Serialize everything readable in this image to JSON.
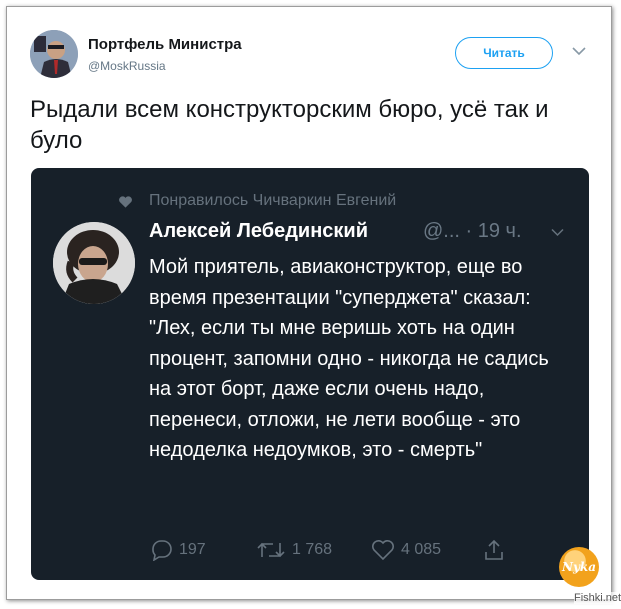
{
  "tweet": {
    "author_name": "Портфель Министра",
    "author_handle": "@MoskRussia",
    "follow_label": "Читать",
    "text": "Рыдали всем конструкторским бюро, усё так и було"
  },
  "embedded": {
    "liked_by": "Понравилось Чичваркин Евгений",
    "author_name": "Алексей Лебединский",
    "meta": "@... · 19 ч.",
    "text": "Мой приятель, авиаконструктор, еще во время презентации \"суперджета\" сказал: \"Лех, если ты мне веришь хоть на один процент, запомни одно - никогда не садись на этот борт, даже если очень надо, перенеси, отложи, не лети вообще - это недоделка недоумков, это - смерть\"",
    "actions": {
      "replies": "197",
      "retweets": "1 768",
      "likes": "4 085"
    }
  },
  "watermark": {
    "logo_text": "Nyka",
    "site": "Fishki.net"
  },
  "colors": {
    "accent": "#1da1f2",
    "card_bg": "#172029",
    "muted": "#66727d"
  }
}
